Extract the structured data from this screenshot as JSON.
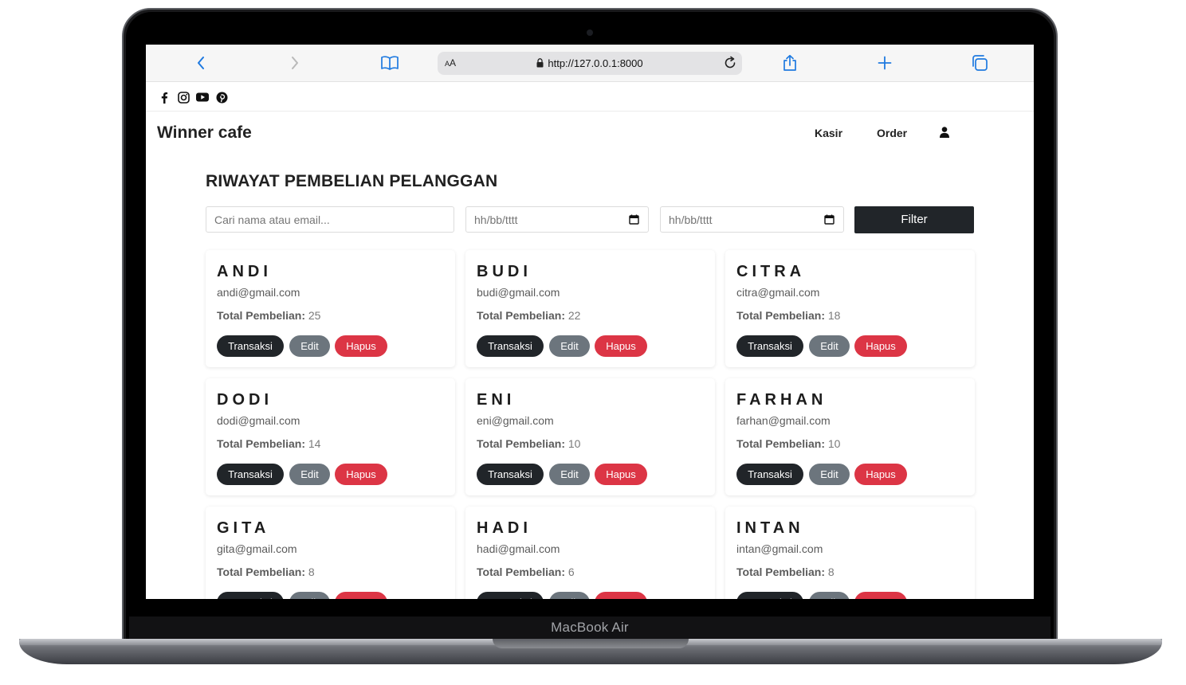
{
  "device": {
    "label": "MacBook Air"
  },
  "browser": {
    "url": "http://127.0.0.1:8000",
    "text_size_label": "AA",
    "icons": [
      "back-icon",
      "forward-icon",
      "bookmarks-icon",
      "lock-icon",
      "reload-icon",
      "share-icon",
      "new-tab-icon",
      "tabs-icon"
    ]
  },
  "social": {
    "icons": [
      "facebook-icon",
      "instagram-icon",
      "youtube-icon",
      "pinterest-icon"
    ]
  },
  "nav": {
    "brand": "Winner cafe",
    "links": [
      "Kasir",
      "Order"
    ],
    "user_icon": "user-icon"
  },
  "page": {
    "title": "RIWAYAT PEMBELIAN PELANGGAN",
    "search_placeholder": "Cari nama atau email...",
    "date_from_placeholder": "hh/bb/tttt",
    "date_to_placeholder": "hh/bb/tttt",
    "filter_label": "Filter",
    "total_label": "Total Pembelian:",
    "buttons": {
      "transaksi": "Transaksi",
      "edit": "Edit",
      "hapus": "Hapus"
    }
  },
  "colors": {
    "dark": "#212529",
    "secondary": "#6c757d",
    "danger": "#dc3545",
    "link": "#1f7ae0"
  },
  "customers": [
    {
      "name": "ANDI",
      "email": "andi@gmail.com",
      "total": "25"
    },
    {
      "name": "BUDI",
      "email": "budi@gmail.com",
      "total": "22"
    },
    {
      "name": "CITRA",
      "email": "citra@gmail.com",
      "total": "18"
    },
    {
      "name": "DODI",
      "email": "dodi@gmail.com",
      "total": "14"
    },
    {
      "name": "ENI",
      "email": "eni@gmail.com",
      "total": "10"
    },
    {
      "name": "FARHAN",
      "email": "farhan@gmail.com",
      "total": "10"
    },
    {
      "name": "GITA",
      "email": "gita@gmail.com",
      "total": "8"
    },
    {
      "name": "HADI",
      "email": "hadi@gmail.com",
      "total": "6"
    },
    {
      "name": "INTAN",
      "email": "intan@gmail.com",
      "total": "8"
    }
  ]
}
